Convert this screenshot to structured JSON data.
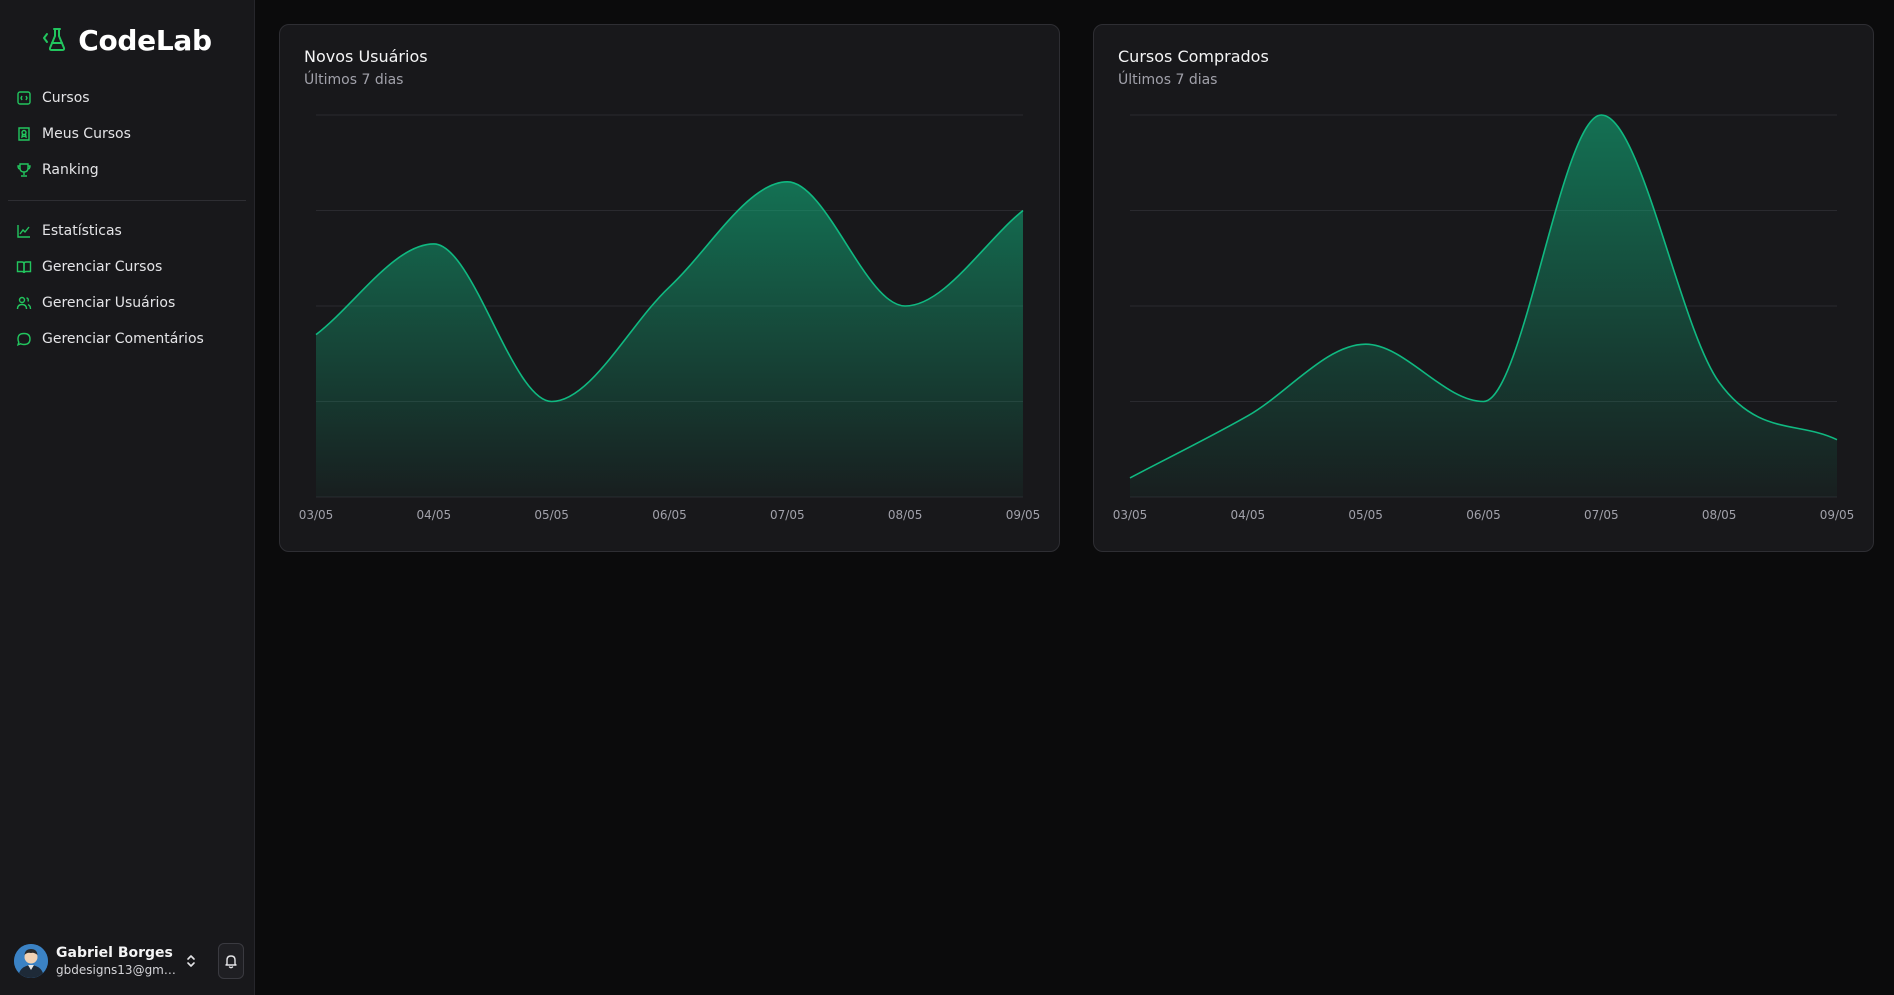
{
  "brand": {
    "name": "CodeLab",
    "accent": "#22c55e"
  },
  "nav": {
    "primary": [
      {
        "label": "Cursos",
        "icon": "course-icon"
      },
      {
        "label": "Meus Cursos",
        "icon": "book-badge-icon"
      },
      {
        "label": "Ranking",
        "icon": "trophy-icon"
      }
    ],
    "admin": [
      {
        "label": "Estatísticas",
        "icon": "chart-icon"
      },
      {
        "label": "Gerenciar Cursos",
        "icon": "open-book-icon"
      },
      {
        "label": "Gerenciar Usuários",
        "icon": "users-icon"
      },
      {
        "label": "Gerenciar Comentários",
        "icon": "comment-icon"
      }
    ]
  },
  "user": {
    "name": "Gabriel Borges",
    "email": "gbdesigns13@gma..."
  },
  "cards": [
    {
      "title": "Novos Usuários",
      "subtitle": "Últimos 7 dias"
    },
    {
      "title": "Cursos Comprados",
      "subtitle": "Últimos 7 dias"
    }
  ],
  "chart_data": [
    {
      "type": "area",
      "title": "Novos Usuários",
      "subtitle": "Últimos 7 dias",
      "categories": [
        "03/05",
        "04/05",
        "05/05",
        "06/05",
        "07/05",
        "08/05",
        "09/05"
      ],
      "values": [
        1.7,
        2.65,
        1.0,
        2.2,
        3.3,
        2.0,
        3.0
      ],
      "ylim": [
        0,
        4
      ],
      "grid": "horizontal",
      "color": "#10b981"
    },
    {
      "type": "area",
      "title": "Cursos Comprados",
      "subtitle": "Últimos 7 dias",
      "categories": [
        "03/05",
        "04/05",
        "05/05",
        "06/05",
        "07/05",
        "08/05",
        "09/05"
      ],
      "values": [
        0.2,
        0.85,
        1.6,
        1.0,
        4.0,
        1.2,
        0.6
      ],
      "ylim": [
        0,
        4
      ],
      "grid": "horizontal",
      "color": "#10b981"
    }
  ]
}
